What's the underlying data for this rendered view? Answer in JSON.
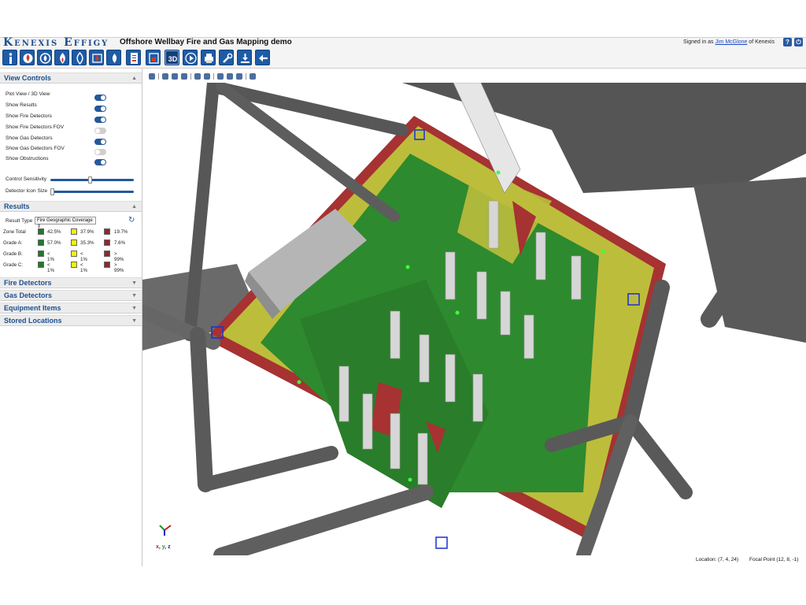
{
  "header": {
    "logo": "Kenexis Effigy",
    "title": "Offshore Wellbay Fire and Gas Mapping demo",
    "signed_prefix": "Signed in as ",
    "user": "Jim McGlone",
    "signed_suffix": " of Kenexis",
    "help_icon": "?",
    "power_icon": "⏻"
  },
  "toolbar": {
    "buttons": [
      "info-icon",
      "fire-detector-icon",
      "fire-icon",
      "fire-hazard-icon",
      "flame-icon",
      "fire-zone-icon",
      "gas-detector-icon",
      "document-icon",
      "report-icon",
      "3d-view-icon",
      "play-icon",
      "print-icon",
      "tools-icon",
      "download-icon",
      "back-arrow-icon"
    ],
    "label_3d": "3D"
  },
  "view_controls": {
    "title": "View Controls",
    "rows": [
      {
        "label": "Plot View / 3D View",
        "on": true
      },
      {
        "label": "Show Results",
        "on": true
      },
      {
        "label": "Show Fire Detectors",
        "on": true
      },
      {
        "label": "Show Fire Detectors FOV",
        "on": false
      },
      {
        "label": "Show Gas Detectors",
        "on": true
      },
      {
        "label": "Show Gas Detectors FOV",
        "on": false
      },
      {
        "label": "Show Obstructions",
        "on": true
      }
    ],
    "sliders": [
      {
        "label": "Control Sensitivity",
        "value": 0.5
      },
      {
        "label": "Detector Icon Size",
        "value": 0.02
      }
    ]
  },
  "results": {
    "title": "Results",
    "result_type_label": "Result Type",
    "result_type_value": "Fire Geographic Coverage",
    "rows": [
      {
        "label": "Zone Total",
        "green": "42.5%",
        "yellow": "37.9%",
        "red": "19.7%"
      },
      {
        "label": "Grade A:",
        "green": "57.0%",
        "yellow": "35.3%",
        "red": "7.6%"
      },
      {
        "label": "Grade B:",
        "green": "< 1%",
        "yellow": "< 1%",
        "red": "> 99%"
      },
      {
        "label": "Grade C:",
        "green": "< 1%",
        "yellow": "< 1%",
        "red": "> 99%"
      }
    ]
  },
  "sections": [
    "Fire Detectors",
    "Gas Detectors",
    "Equipment Items",
    "Stored Locations"
  ],
  "viewport": {
    "location": "Location: (7, 4, 24)",
    "focal_point": "Focal Point (12, 8, -1)",
    "axes": [
      "x",
      "y",
      "z"
    ],
    "colors": {
      "green": "#2e8a2e",
      "yellow": "#bdbd3c",
      "red": "#a63232",
      "structure": "#555555",
      "equipment": "#cfcfcf"
    }
  }
}
